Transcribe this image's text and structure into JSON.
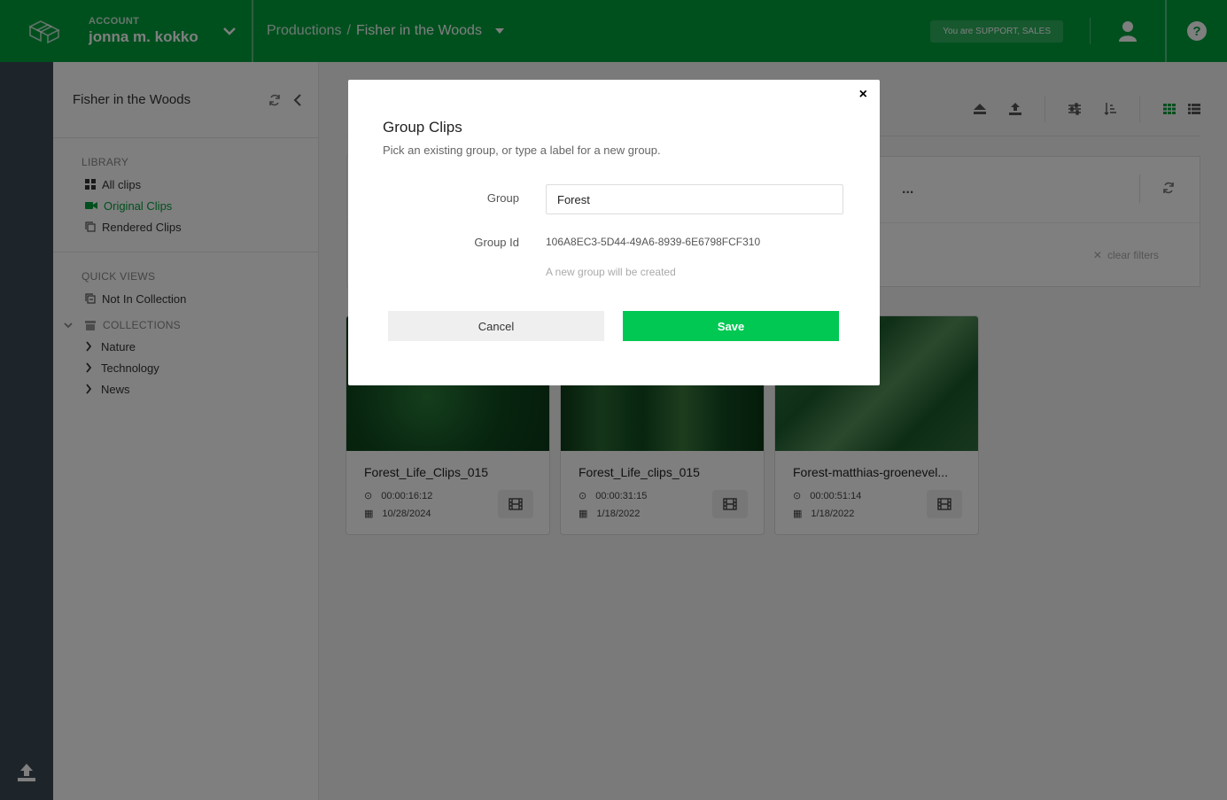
{
  "header": {
    "account_label": "ACCOUNT",
    "account_name": "jonna m. kokko",
    "breadcrumb_root": "Productions",
    "breadcrumb_sep": "/",
    "breadcrumb_current": "Fisher in the Woods",
    "role_badge": "You are SUPPORT, SALES"
  },
  "sidebar": {
    "title": "Fisher in the Woods",
    "library_heading": "LIBRARY",
    "library_items": [
      "All clips",
      "Original Clips",
      "Rendered Clips"
    ],
    "quick_views_heading": "QUICK VIEWS",
    "quick_views_items": [
      "Not In Collection"
    ],
    "collections_heading": "COLLECTIONS",
    "collections": [
      "Nature",
      "Technology",
      "News"
    ]
  },
  "filters": {
    "more": "...",
    "clear_label": "clear filters"
  },
  "cards": [
    {
      "title": "Forest_Life_Clips_015",
      "duration": "00:00:16:12",
      "date": "10/28/2024"
    },
    {
      "title": "Forest_Life_clips_015",
      "duration": "00:00:31:15",
      "date": "1/18/2022"
    },
    {
      "title": "Forest-matthias-groenevel...",
      "duration": "00:00:51:14",
      "date": "1/18/2022"
    }
  ],
  "modal": {
    "close": "×",
    "title": "Group Clips",
    "subtitle": "Pick an existing group, or type a label for a new group.",
    "group_label": "Group",
    "group_value": "Forest",
    "group_id_label": "Group Id",
    "group_id_value": "106A8EC3-5D44-49A6-8939-6E6798FCF310",
    "hint": "A new group will be created",
    "cancel_label": "Cancel",
    "save_label": "Save"
  },
  "colors": {
    "brand_green": "#00a03c",
    "save_green": "#00c853",
    "rail": "#3d4a54"
  }
}
